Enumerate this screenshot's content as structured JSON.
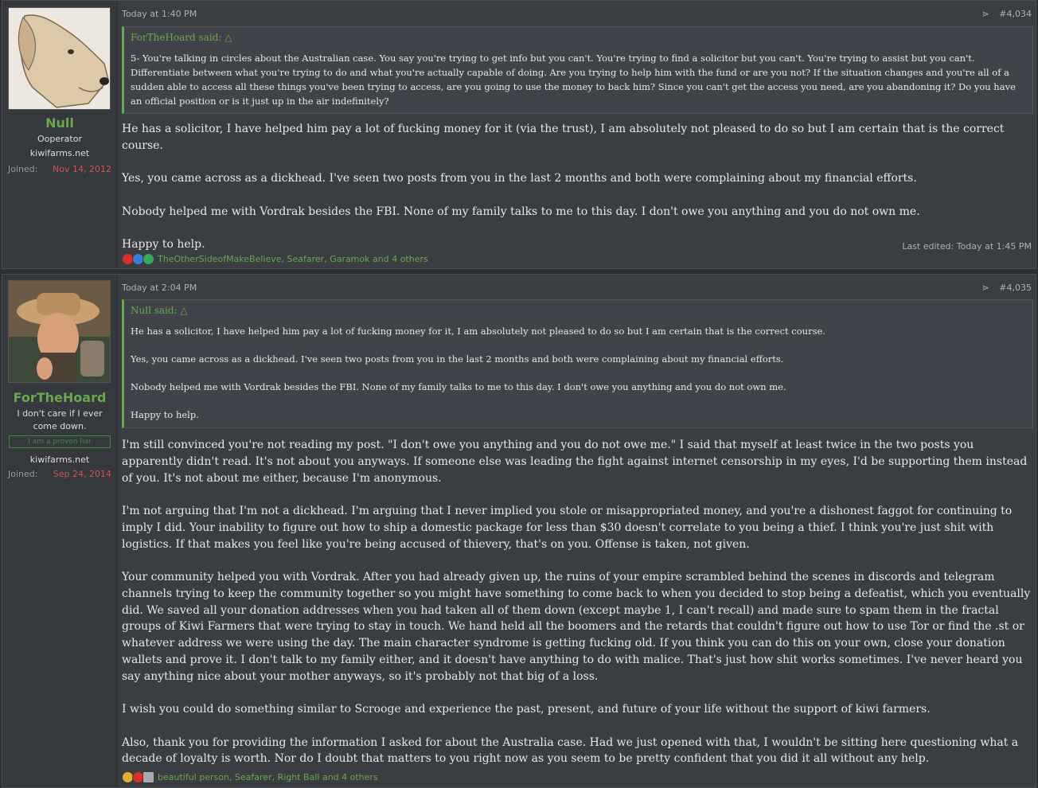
{
  "posts": [
    {
      "username": "Null",
      "user_title": "Ooperator",
      "site": "kiwifarms.net",
      "joined_label": "Joined:",
      "joined_date": "Nov 14, 2012",
      "date": "Today at 1:40 PM",
      "post_number": "#4,034",
      "quote_author": "ForTheHoard said:",
      "quote_paragraphs": [
        "5- You're talking in circles about the Australian case. You say you're trying to get info but you can't. You're trying to find a solicitor but you can't. You're trying to assist but you can't. Differentiate between what you're trying to do and what you're actually capable of doing. Are you trying to help him with the fund or are you not? If the situation changes and you're all of a sudden able to access all these things you've been trying to access, are you going to use the money to back him? Since you can't get the access you need, are you abandoning it? Do you have an official position or is it just up in the air indefinitely?"
      ],
      "paragraphs": [
        "He has a solicitor, I have helped him pay a lot of fucking money for it (via the trust), I am absolutely not pleased to do so but I am certain that is the correct course.",
        "Yes, you came across as a dickhead. I've seen two posts from you in the last 2 months and both were complaining about my financial efforts.",
        "Nobody helped me with Vordrak besides the FBI. None of my family talks to me to this day. I don't owe you anything and you do not own me.",
        "Happy to help."
      ],
      "last_edited": "Last edited: Today at 1:45 PM",
      "reactions_text": "TheOtherSideofMakeBelieve, Seafarer, Garamok and 4 others"
    },
    {
      "username": "ForTheHoard",
      "user_title": "I don't care if I ever come down.",
      "banner": "I am a proven liar",
      "site": "kiwifarms.net",
      "joined_label": "Joined:",
      "joined_date": "Sep 24, 2014",
      "date": "Today at 2:04 PM",
      "post_number": "#4,035",
      "quote_author": "Null said:",
      "quote_paragraphs": [
        "He has a solicitor, I have helped him pay a lot of fucking money for it, I am absolutely not pleased to do so but I am certain that is the correct course.",
        "Yes, you came across as a dickhead. I've seen two posts from you in the last 2 months and both were complaining about my financial efforts.",
        "Nobody helped me with Vordrak besides the FBI. None of my family talks to me to this day. I don't owe you anything and you do not own me.",
        "Happy to help."
      ],
      "paragraphs": [
        "I'm still convinced you're not reading my post. \"I don't owe you anything and you do not owe me.\" I said that myself at least twice in the two posts you apparently didn't read. It's not about you anyways. If someone else was leading the fight against internet censorship in my eyes, I'd be supporting them instead of you. It's not about me either, because I'm anonymous.",
        "I'm not arguing that I'm not a dickhead. I'm arguing that I never implied you stole or misappropriated money, and you're a dishonest faggot for continuing to imply I did. Your inability to figure out how to ship a domestic package for less than $30 doesn't correlate to you being a thief. I think you're just shit with logistics. If that makes you feel like you're being accused of thievery, that's on you. Offense is taken, not given.",
        "Your community helped you with Vordrak. After you had already given up, the ruins of your empire scrambled behind the scenes in discords and telegram channels trying to keep the community together so you might have something to come back to when you decided to stop being a defeatist, which you eventually did. We saved all your donation addresses when you had taken all of them down (except maybe 1, I can't recall) and made sure to spam them in the fractal groups of Kiwi Farmers that were trying to stay in touch. We hand held all the boomers and the retards that couldn't figure out how to use Tor or find the .st or whatever address we were using the day. The main character syndrome is getting fucking old. If you think you can do this on your own, close your donation wallets and prove it. I don't talk to my family either, and it doesn't have anything to do with malice. That's just how shit works sometimes. I've never heard you say anything nice about your mother anyways, so it's probably not that big of a loss.",
        "I wish you could do something similar to Scrooge and experience the past, present, and future of your life without the support of kiwi farmers.",
        "Also, thank you for providing the information I asked for about the Australia case. Had we just opened with that, I wouldn't be sitting here questioning what a decade of loyalty is worth. Nor do I doubt that matters to you right now as you seem to be pretty confident that you did it all without any help."
      ],
      "reactions_text": "beautiful person, Seafarer, Right Ball and 4 others"
    }
  ],
  "colors": {
    "accent": "#6aa84f",
    "joined_date": "#d9534f",
    "background": "#3a3d42"
  }
}
